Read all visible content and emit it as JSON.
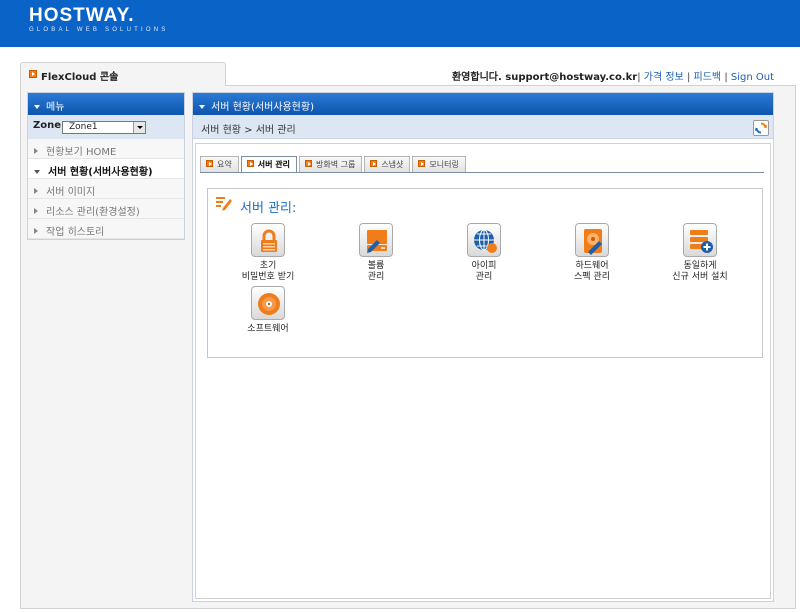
{
  "header": {
    "logo_text": "HOSTWAY.",
    "logo_tagline": "GLOBAL WEB SOLUTIONS",
    "brand_color": "#0a63c7"
  },
  "console_tab": {
    "label": "FlexCloud 콘솔"
  },
  "top_links": {
    "welcome": "환영합니다. support@hostway.co.kr",
    "pricing": "가격 정보",
    "feedback": "피드백",
    "sign_out": "Sign Out",
    "separator": "|"
  },
  "sidebar": {
    "title": "메뉴",
    "zone_label": "Zone:",
    "zone_value": "Zone1",
    "items": [
      {
        "label": "현황보기 HOME",
        "active": false
      },
      {
        "label": "서버 현황(서버사용현황)",
        "active": true
      },
      {
        "label": "서버 이미지",
        "active": false
      },
      {
        "label": "리소스 관리(환경설정)",
        "active": false
      },
      {
        "label": "작업 히스토리",
        "active": false
      }
    ]
  },
  "content": {
    "title": "서버 현황(서버사용현황)",
    "breadcrumb": "서버 현황 >  서버 관리",
    "refresh_icon": "refresh-icon",
    "tabs": [
      {
        "label": "요약",
        "active": false
      },
      {
        "label": "서버 관리",
        "active": true
      },
      {
        "label": "방화벽 그룹",
        "active": false
      },
      {
        "label": "스냅샷",
        "active": false
      },
      {
        "label": "모니터링",
        "active": false
      }
    ],
    "section_title": "서버 관리:",
    "apps": [
      {
        "label": "초기\n비밀번호 받기",
        "icon": "lock-icon"
      },
      {
        "label": "볼륨\n관리",
        "icon": "volume-icon"
      },
      {
        "label": "아이피\n관리",
        "icon": "globe-ip-icon"
      },
      {
        "label": "하드웨어\n스펙 관리",
        "icon": "hardware-spec-icon"
      },
      {
        "label": "동일하게\n신규 서버 설치",
        "icon": "add-server-icon"
      },
      {
        "label": "소프트웨어",
        "icon": "software-disc-icon"
      }
    ],
    "accent_color": "#f07d1a"
  }
}
